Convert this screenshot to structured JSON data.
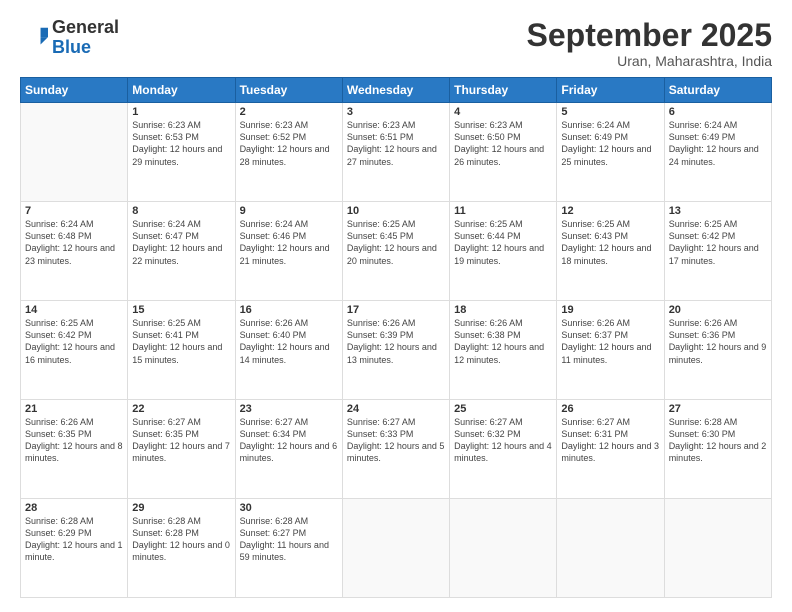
{
  "header": {
    "logo_general": "General",
    "logo_blue": "Blue",
    "month_title": "September 2025",
    "location": "Uran, Maharashtra, India"
  },
  "days_of_week": [
    "Sunday",
    "Monday",
    "Tuesday",
    "Wednesday",
    "Thursday",
    "Friday",
    "Saturday"
  ],
  "weeks": [
    [
      {
        "num": "",
        "sunrise": "",
        "sunset": "",
        "daylight": ""
      },
      {
        "num": "1",
        "sunrise": "6:23 AM",
        "sunset": "6:53 PM",
        "daylight": "12 hours and 29 minutes."
      },
      {
        "num": "2",
        "sunrise": "6:23 AM",
        "sunset": "6:52 PM",
        "daylight": "12 hours and 28 minutes."
      },
      {
        "num": "3",
        "sunrise": "6:23 AM",
        "sunset": "6:51 PM",
        "daylight": "12 hours and 27 minutes."
      },
      {
        "num": "4",
        "sunrise": "6:23 AM",
        "sunset": "6:50 PM",
        "daylight": "12 hours and 26 minutes."
      },
      {
        "num": "5",
        "sunrise": "6:24 AM",
        "sunset": "6:49 PM",
        "daylight": "12 hours and 25 minutes."
      },
      {
        "num": "6",
        "sunrise": "6:24 AM",
        "sunset": "6:49 PM",
        "daylight": "12 hours and 24 minutes."
      }
    ],
    [
      {
        "num": "7",
        "sunrise": "6:24 AM",
        "sunset": "6:48 PM",
        "daylight": "12 hours and 23 minutes."
      },
      {
        "num": "8",
        "sunrise": "6:24 AM",
        "sunset": "6:47 PM",
        "daylight": "12 hours and 22 minutes."
      },
      {
        "num": "9",
        "sunrise": "6:24 AM",
        "sunset": "6:46 PM",
        "daylight": "12 hours and 21 minutes."
      },
      {
        "num": "10",
        "sunrise": "6:25 AM",
        "sunset": "6:45 PM",
        "daylight": "12 hours and 20 minutes."
      },
      {
        "num": "11",
        "sunrise": "6:25 AM",
        "sunset": "6:44 PM",
        "daylight": "12 hours and 19 minutes."
      },
      {
        "num": "12",
        "sunrise": "6:25 AM",
        "sunset": "6:43 PM",
        "daylight": "12 hours and 18 minutes."
      },
      {
        "num": "13",
        "sunrise": "6:25 AM",
        "sunset": "6:42 PM",
        "daylight": "12 hours and 17 minutes."
      }
    ],
    [
      {
        "num": "14",
        "sunrise": "6:25 AM",
        "sunset": "6:42 PM",
        "daylight": "12 hours and 16 minutes."
      },
      {
        "num": "15",
        "sunrise": "6:25 AM",
        "sunset": "6:41 PM",
        "daylight": "12 hours and 15 minutes."
      },
      {
        "num": "16",
        "sunrise": "6:26 AM",
        "sunset": "6:40 PM",
        "daylight": "12 hours and 14 minutes."
      },
      {
        "num": "17",
        "sunrise": "6:26 AM",
        "sunset": "6:39 PM",
        "daylight": "12 hours and 13 minutes."
      },
      {
        "num": "18",
        "sunrise": "6:26 AM",
        "sunset": "6:38 PM",
        "daylight": "12 hours and 12 minutes."
      },
      {
        "num": "19",
        "sunrise": "6:26 AM",
        "sunset": "6:37 PM",
        "daylight": "12 hours and 11 minutes."
      },
      {
        "num": "20",
        "sunrise": "6:26 AM",
        "sunset": "6:36 PM",
        "daylight": "12 hours and 9 minutes."
      }
    ],
    [
      {
        "num": "21",
        "sunrise": "6:26 AM",
        "sunset": "6:35 PM",
        "daylight": "12 hours and 8 minutes."
      },
      {
        "num": "22",
        "sunrise": "6:27 AM",
        "sunset": "6:35 PM",
        "daylight": "12 hours and 7 minutes."
      },
      {
        "num": "23",
        "sunrise": "6:27 AM",
        "sunset": "6:34 PM",
        "daylight": "12 hours and 6 minutes."
      },
      {
        "num": "24",
        "sunrise": "6:27 AM",
        "sunset": "6:33 PM",
        "daylight": "12 hours and 5 minutes."
      },
      {
        "num": "25",
        "sunrise": "6:27 AM",
        "sunset": "6:32 PM",
        "daylight": "12 hours and 4 minutes."
      },
      {
        "num": "26",
        "sunrise": "6:27 AM",
        "sunset": "6:31 PM",
        "daylight": "12 hours and 3 minutes."
      },
      {
        "num": "27",
        "sunrise": "6:28 AM",
        "sunset": "6:30 PM",
        "daylight": "12 hours and 2 minutes."
      }
    ],
    [
      {
        "num": "28",
        "sunrise": "6:28 AM",
        "sunset": "6:29 PM",
        "daylight": "12 hours and 1 minute."
      },
      {
        "num": "29",
        "sunrise": "6:28 AM",
        "sunset": "6:28 PM",
        "daylight": "12 hours and 0 minutes."
      },
      {
        "num": "30",
        "sunrise": "6:28 AM",
        "sunset": "6:27 PM",
        "daylight": "11 hours and 59 minutes."
      },
      {
        "num": "",
        "sunrise": "",
        "sunset": "",
        "daylight": ""
      },
      {
        "num": "",
        "sunrise": "",
        "sunset": "",
        "daylight": ""
      },
      {
        "num": "",
        "sunrise": "",
        "sunset": "",
        "daylight": ""
      },
      {
        "num": "",
        "sunrise": "",
        "sunset": "",
        "daylight": ""
      }
    ]
  ]
}
